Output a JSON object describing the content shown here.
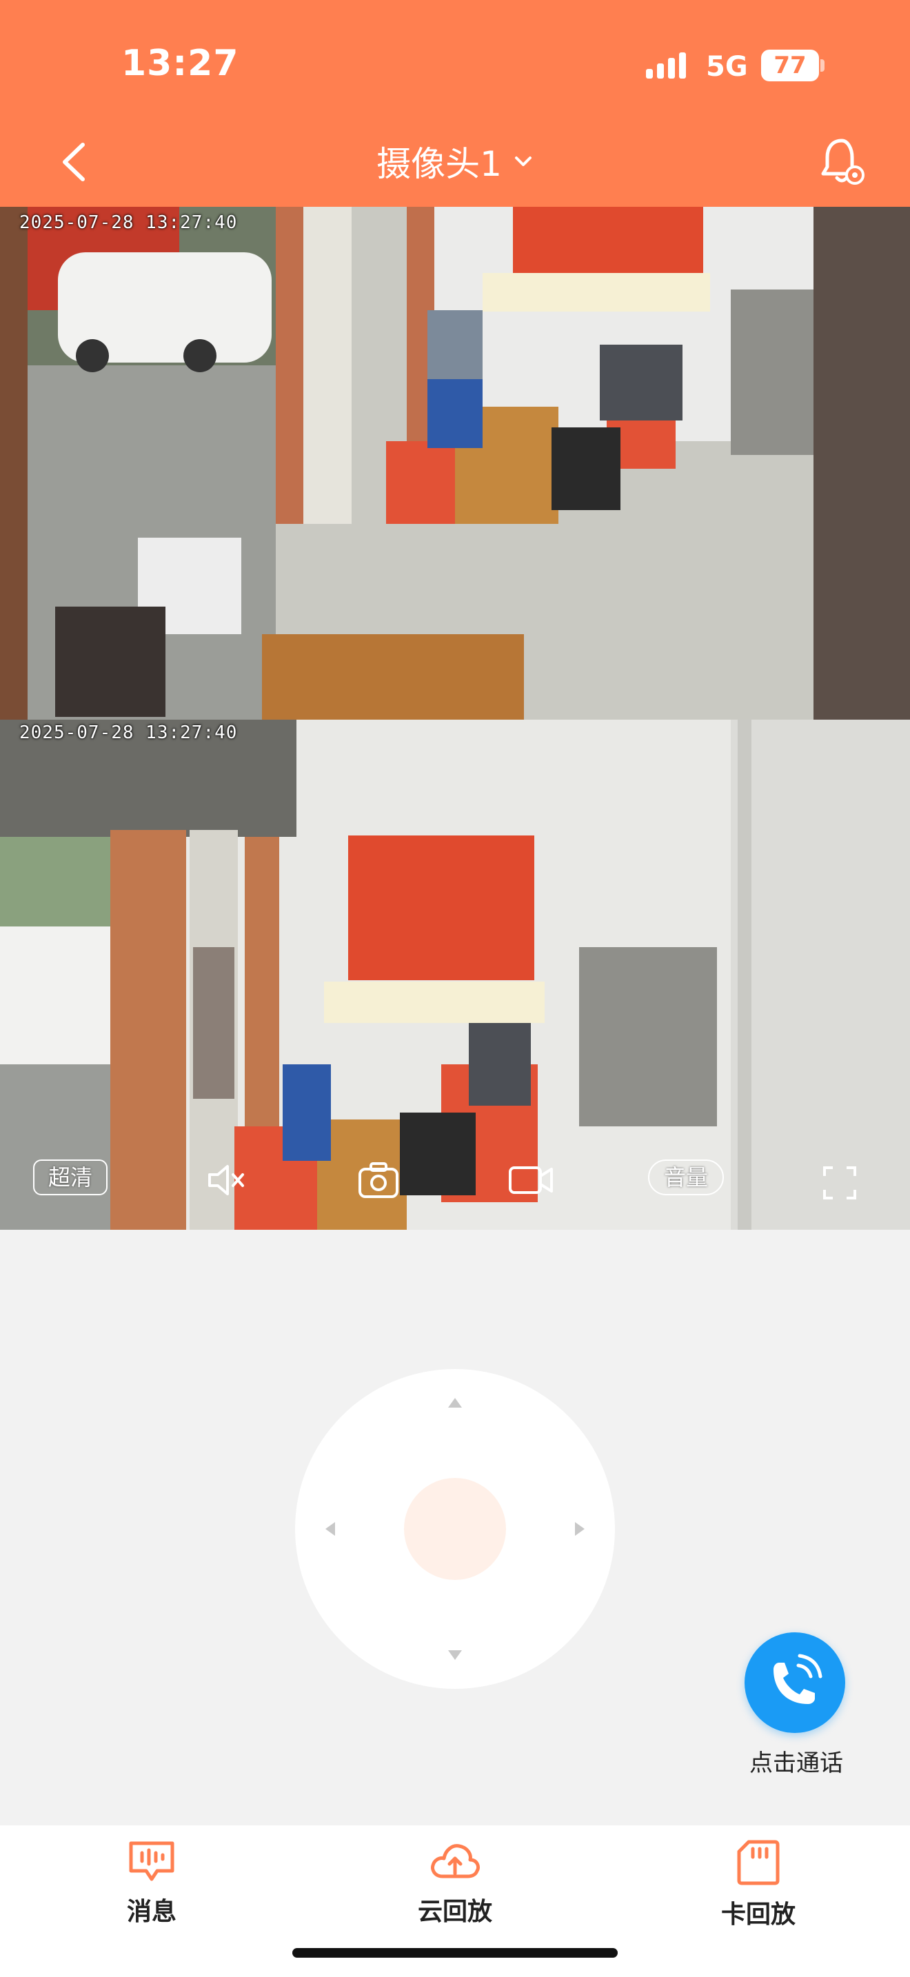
{
  "status_bar": {
    "time": "13:27",
    "network": "5G",
    "battery": "77"
  },
  "header": {
    "title": "摄像头1"
  },
  "feeds": [
    {
      "timestamp": "2025-07-28 13:27:40"
    },
    {
      "timestamp": "2025-07-28 13:27:40"
    }
  ],
  "controls": {
    "quality_label": "超清",
    "volume_label": "音量"
  },
  "call": {
    "label": "点击通话"
  },
  "tabs": [
    {
      "label": "消息",
      "icon": "message-icon"
    },
    {
      "label": "云回放",
      "icon": "cloud-upload-icon"
    },
    {
      "label": "卡回放",
      "icon": "sd-card-icon"
    }
  ],
  "colors": {
    "header": "#ff7f50",
    "call_button": "#1a9bf5",
    "ptz_center": "#fff0e8"
  }
}
